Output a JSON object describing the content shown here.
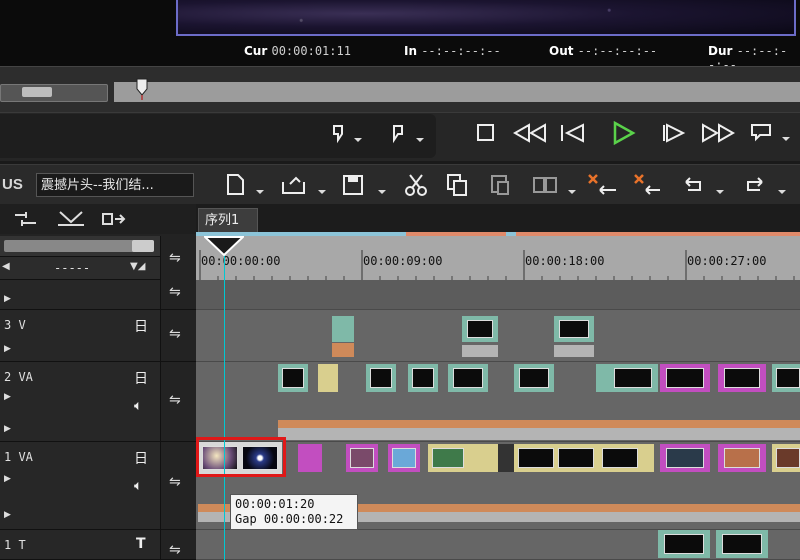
{
  "preview": {
    "cur_label": "Cur",
    "cur_value": "00:00:01:11",
    "in_label": "In",
    "in_value": "--:--:--:--",
    "out_label": "Out",
    "out_value": "--:--:--:--",
    "dur_label": "Dur",
    "dur_value": "--:--:--:--"
  },
  "toolbar": {
    "brand": "US",
    "sequence_name": "震撼片头--我们结..."
  },
  "tab": {
    "label": "序列1"
  },
  "ruler": {
    "labels": [
      "00:00:00:00",
      "00:00:09:00",
      "00:00:18:00",
      "00:00:27:00"
    ]
  },
  "tracks": {
    "top_dropdown": "-----",
    "names": [
      "3 V",
      "2 VA",
      "1 VA",
      "1 T"
    ]
  },
  "tooltip": {
    "line1": "00:00:01:20",
    "line2": "Gap 00:00:00:22"
  },
  "colors": {
    "clip_teal": "#7fb9a8",
    "clip_magenta": "#c24ec0",
    "clip_yellow": "#d9cf8e",
    "clip_grey": "#b4b4b4",
    "clip_orange": "#cf8a5a",
    "playhead": "#00c8d2",
    "selection": "#e01818",
    "play_green": "#5ad24a"
  }
}
